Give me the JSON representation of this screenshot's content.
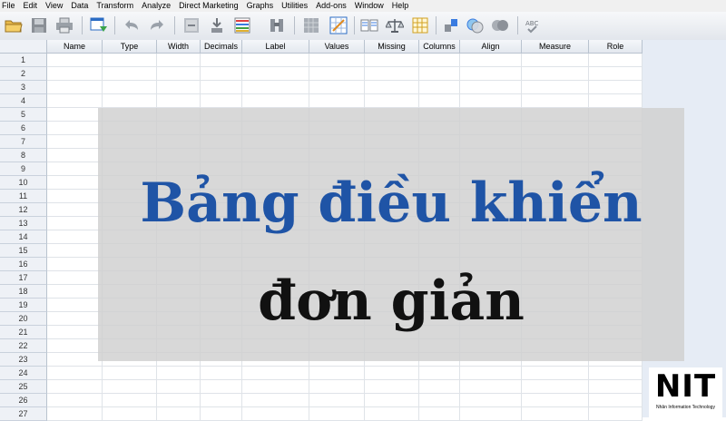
{
  "menu": {
    "items": [
      "File",
      "Edit",
      "View",
      "Data",
      "Transform",
      "Analyze",
      "Direct Marketing",
      "Graphs",
      "Utilities",
      "Add-ons",
      "Window",
      "Help"
    ]
  },
  "toolbar": {
    "icons": [
      "open-folder-icon",
      "save-icon",
      "print-icon",
      "dialog-recall-icon",
      "undo-icon",
      "redo-icon",
      "goto-case-icon",
      "goto-variable-icon",
      "variables-icon",
      "find-icon",
      "insert-cases-icon",
      "insert-variable-icon",
      "split-file-icon",
      "weight-cases-icon",
      "select-cases-icon",
      "value-labels-icon",
      "use-sets-icon",
      "show-all-variables-icon",
      "spell-check-icon"
    ]
  },
  "grid": {
    "columns": [
      "Name",
      "Type",
      "Width",
      "Decimals",
      "Label",
      "Values",
      "Missing",
      "Columns",
      "Align",
      "Measure",
      "Role"
    ],
    "row_numbers": [
      "1",
      "2",
      "3",
      "4",
      "5",
      "6",
      "7",
      "8",
      "9",
      "10",
      "11",
      "12",
      "13",
      "14",
      "15",
      "16",
      "17",
      "18",
      "19",
      "20",
      "21",
      "22",
      "23",
      "24",
      "25",
      "26",
      "27"
    ]
  },
  "overlay": {
    "line1": "Bảng điều khiển",
    "line2": "đơn giản",
    "line1_color": "#1f54a6",
    "line2_color": "#111111"
  },
  "logo": {
    "text": "NIT",
    "subtitle": "Nhân Information Technology"
  }
}
